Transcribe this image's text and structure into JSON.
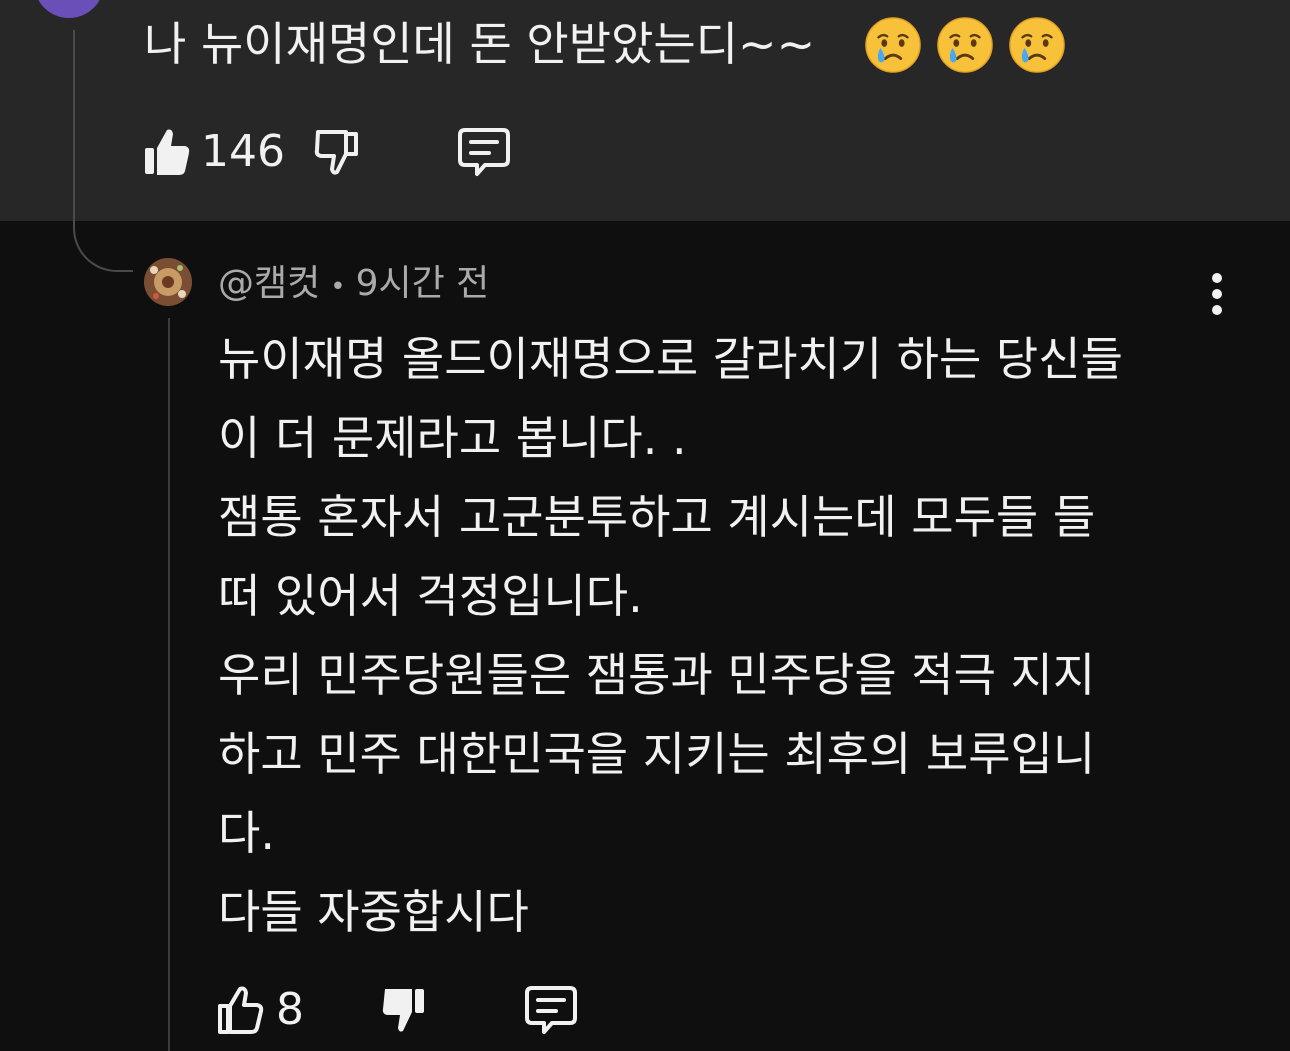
{
  "parent_comment": {
    "text": "나 뉴이재명인데 돈 안받았는디~~",
    "emojis": [
      "crying-face",
      "crying-face",
      "crying-face"
    ],
    "like_count": "146"
  },
  "reply": {
    "author": "@캠컷",
    "separator": "•",
    "time": "9시간 전",
    "lines": [
      "뉴이재명 올드이재명으로 갈라치기 하는 당신들",
      "이 더 문제라고 봅니다.  .",
      "잼통 혼자서 고군분투하고 계시는데 모두들 들",
      "떠 있어서 걱정입니다.",
      "우리 민주당원들은 잼통과 민주당을 적극 지지",
      "하고 민주 대한민국을 지키는 최후의 보루입니",
      "다.",
      "다들 자중합시다"
    ],
    "like_count": "8"
  },
  "colors": {
    "background": "#0f0f0f",
    "highlight_band": "#272727",
    "text": "#f1f1f1",
    "meta_text": "#aaaaaa",
    "parent_avatar": "#6a4fb8"
  }
}
